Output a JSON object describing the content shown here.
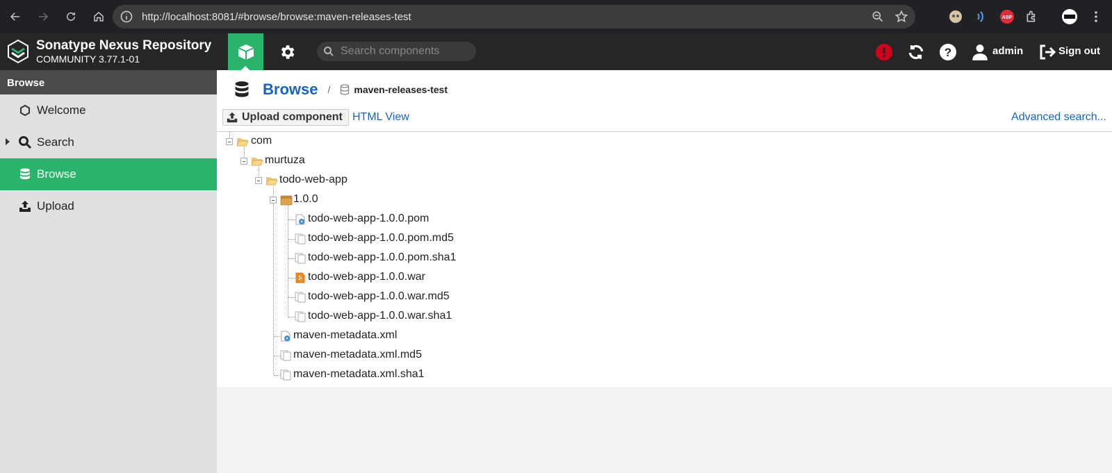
{
  "browser": {
    "url": "http://localhost:8081/#browse/browse:maven-releases-test"
  },
  "header": {
    "brand_title": "Sonatype Nexus Repository",
    "brand_subtitle": "COMMUNITY 3.77.1-01",
    "search_placeholder": "Search components",
    "user": "admin",
    "sign_out": "Sign out"
  },
  "sidebar": {
    "heading": "Browse",
    "items": [
      {
        "label": "Welcome",
        "icon": "hexagon-icon"
      },
      {
        "label": "Search",
        "icon": "search-icon"
      },
      {
        "label": "Browse",
        "icon": "database-icon"
      },
      {
        "label": "Upload",
        "icon": "upload-icon"
      }
    ]
  },
  "main": {
    "title": "Browse",
    "separator": "/",
    "repository": "maven-releases-test",
    "upload_button": "Upload component",
    "html_view": "HTML View",
    "advanced_search": "Advanced search..."
  },
  "tree": [
    {
      "label": "com",
      "icon": "folder-open-icon",
      "depth": 0
    },
    {
      "label": "murtuza",
      "icon": "folder-open-icon",
      "depth": 1
    },
    {
      "label": "todo-web-app",
      "icon": "folder-open-icon",
      "depth": 2
    },
    {
      "label": "1.0.0",
      "icon": "package-icon",
      "depth": 3
    },
    {
      "label": "todo-web-app-1.0.0.pom",
      "icon": "xml-file-icon",
      "depth": 4
    },
    {
      "label": "todo-web-app-1.0.0.pom.md5",
      "icon": "checksum-file-icon",
      "depth": 4
    },
    {
      "label": "todo-web-app-1.0.0.pom.sha1",
      "icon": "checksum-file-icon",
      "depth": 4
    },
    {
      "label": "todo-web-app-1.0.0.war",
      "icon": "archive-file-icon",
      "depth": 4
    },
    {
      "label": "todo-web-app-1.0.0.war.md5",
      "icon": "checksum-file-icon",
      "depth": 4
    },
    {
      "label": "todo-web-app-1.0.0.war.sha1",
      "icon": "checksum-file-icon",
      "depth": 4
    },
    {
      "label": "maven-metadata.xml",
      "icon": "xml-file-icon",
      "depth": 3
    },
    {
      "label": "maven-metadata.xml.md5",
      "icon": "checksum-file-icon",
      "depth": 3
    },
    {
      "label": "maven-metadata.xml.sha1",
      "icon": "checksum-file-icon",
      "depth": 3
    }
  ]
}
